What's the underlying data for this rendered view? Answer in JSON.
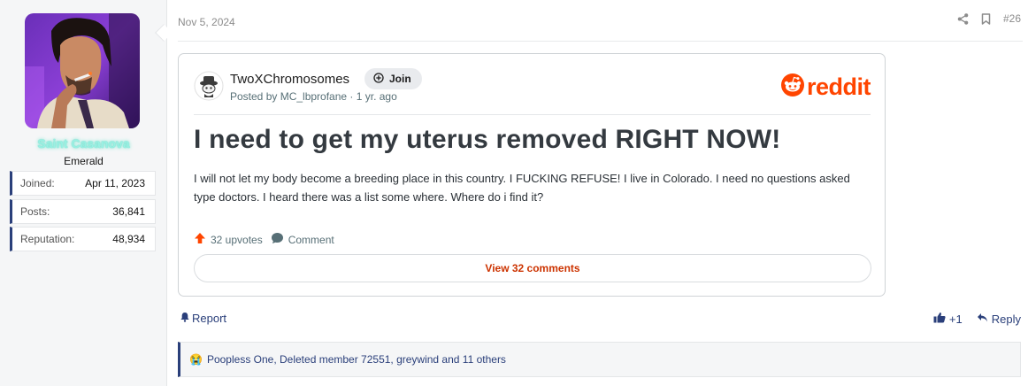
{
  "user": {
    "name": "Saint Casanova",
    "title": "Emerald",
    "stats": [
      {
        "label": "Joined:",
        "value": "Apr 11, 2023"
      },
      {
        "label": "Posts:",
        "value": "36,841"
      },
      {
        "label": "Reputation:",
        "value": "48,934"
      }
    ]
  },
  "post": {
    "date": "Nov 5, 2024",
    "number": "#26",
    "icons": {
      "share": "share-icon",
      "bookmark": "bookmark-icon"
    }
  },
  "embed": {
    "subreddit": "TwoXChromosomes",
    "join_label": "Join",
    "posted_by": "Posted by MC_lbprofane · 1 yr. ago",
    "brand": "reddit",
    "brand_color": "#ff4500",
    "title": "I need to get my uterus removed RIGHT NOW!",
    "body": "I will not let my body become a breeding place in this country. I FUCKING REFUSE! I live in Colorado. I need no questions asked type doctors. I heard there was a list some where. Where do i find it?",
    "upvotes": "32 upvotes",
    "comment_label": "Comment",
    "view_comments": "View 32 comments"
  },
  "actions": {
    "report": "Report",
    "like_count": "+1",
    "reply": "Reply"
  },
  "reactions": {
    "emoji": "😭",
    "text": "Poopless One, Deleted member 72551, greywind and 11 others"
  },
  "colors": {
    "accent": "#2a3f7a",
    "username_glow": "#9af0e3",
    "reddit_orange": "#ff4500",
    "view_comments_text": "#cc3300"
  }
}
